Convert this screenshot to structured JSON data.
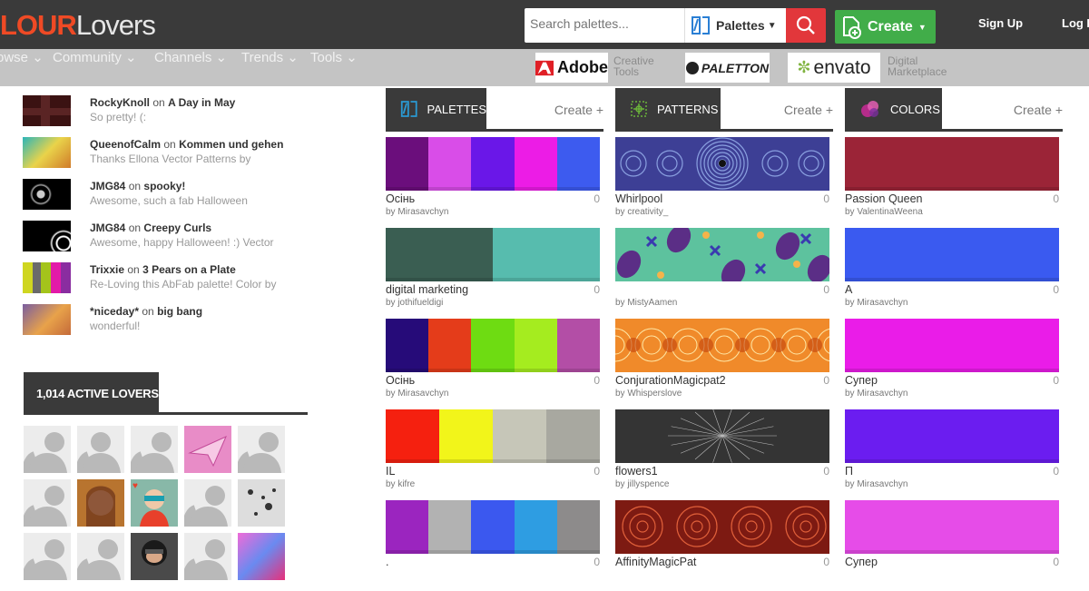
{
  "header": {
    "logo_part1": "LOUR",
    "logo_part2": "Lovers",
    "search_placeholder": "Search palettes...",
    "search_type": "Palettes",
    "create_label": "Create",
    "signup_label": "Sign Up",
    "login_label": "Log In"
  },
  "nav": {
    "items": [
      "owse",
      "Community",
      "Channels",
      "Trends",
      "Tools"
    ]
  },
  "partners": {
    "adobe": "Adobe",
    "adobe_tag": "Creative Tools",
    "paletton": "PALETTON",
    "envato": "envato",
    "envato_tag": "Digital Marketplace"
  },
  "comments": [
    {
      "user": "RockyKnoll",
      "on": "on",
      "target": "A Day in May",
      "text": "So pretty! (:"
    },
    {
      "user": "QueenofCalm",
      "on": "on",
      "target": "Kommen und gehen",
      "text": "Thanks Ellona Vector Patterns by"
    },
    {
      "user": "JMG84",
      "on": "on",
      "target": "spooky!",
      "text": "Awesome, such a fab Halloween"
    },
    {
      "user": "JMG84",
      "on": "on",
      "target": "Creepy Curls",
      "text": "Awesome, happy Halloween! :) Vector"
    },
    {
      "user": "Trixxie",
      "on": "on",
      "target": "3 Pears on a Plate",
      "text": "Re-Loving this AbFab palette! Color by"
    },
    {
      "user": "*niceday*",
      "on": "on",
      "target": "big bang",
      "text": "wonderful!"
    }
  ],
  "lovers": {
    "title": "1,014 ACTIVE LOVERS"
  },
  "columns": {
    "palettes": {
      "title": "PALETTES",
      "create": "Create +"
    },
    "patterns": {
      "title": "PATTERNS",
      "create": "Create +"
    },
    "colors": {
      "title": "COLORS",
      "create": "Create +"
    }
  },
  "palettes": [
    {
      "title": "Осінь",
      "by": "by Mirasavchyn",
      "count": "0",
      "colors": [
        "#6b0e7c",
        "#d94de8",
        "#6a17e8",
        "#ec1ce6",
        "#3d5bef"
      ]
    },
    {
      "title": "digital marketing",
      "by": "by jothifueldigi",
      "count": "0",
      "colors": [
        "#3a5e52",
        "#57bcae"
      ]
    },
    {
      "title": "Осінь",
      "by": "by Mirasavchyn",
      "count": "0",
      "colors": [
        "#260b79",
        "#e43c1a",
        "#6edc12",
        "#a5ec1f",
        "#b34ea6"
      ]
    },
    {
      "title": "IL",
      "by": "by kifre",
      "count": "0",
      "colors": [
        "#f5200f",
        "#f2f51a",
        "#c6c6b8",
        "#a8a8a0"
      ]
    },
    {
      "title": ".",
      "by": "",
      "count": "0",
      "colors": [
        "#9b25bf",
        "#b2b2b2",
        "#3b58ef",
        "#2e9de2",
        "#8d8b8b"
      ]
    }
  ],
  "patterns": [
    {
      "title": "Whirlpool",
      "by": "by creativity_",
      "count": "0",
      "bg": "#3d3f95"
    },
    {
      "title": "",
      "by": "by MistyAamen",
      "count": "0",
      "bg": "#5dc29e"
    },
    {
      "title": "ConjurationMagicpat2",
      "by": "by Whisperslove",
      "count": "0",
      "bg": "#f08a2a"
    },
    {
      "title": "flowers1",
      "by": "by jillyspence",
      "count": "0",
      "bg": "#343434"
    },
    {
      "title": "AffinityMagicPat",
      "by": "",
      "count": "0",
      "bg": "#7d1a12"
    }
  ],
  "colors": [
    {
      "title": "Passion Queen",
      "by": "by ValentinaWeena",
      "count": "0",
      "hex": "#9b2437"
    },
    {
      "title": "A",
      "by": "by Mirasavchyn",
      "count": "0",
      "hex": "#3a5af0"
    },
    {
      "title": "Супер",
      "by": "by Mirasavchyn",
      "count": "0",
      "hex": "#ea1ce8"
    },
    {
      "title": "П",
      "by": "by Mirasavchyn",
      "count": "0",
      "hex": "#6b1df0"
    },
    {
      "title": "Супер",
      "by": "",
      "count": "0",
      "hex": "#e64ce8"
    }
  ]
}
